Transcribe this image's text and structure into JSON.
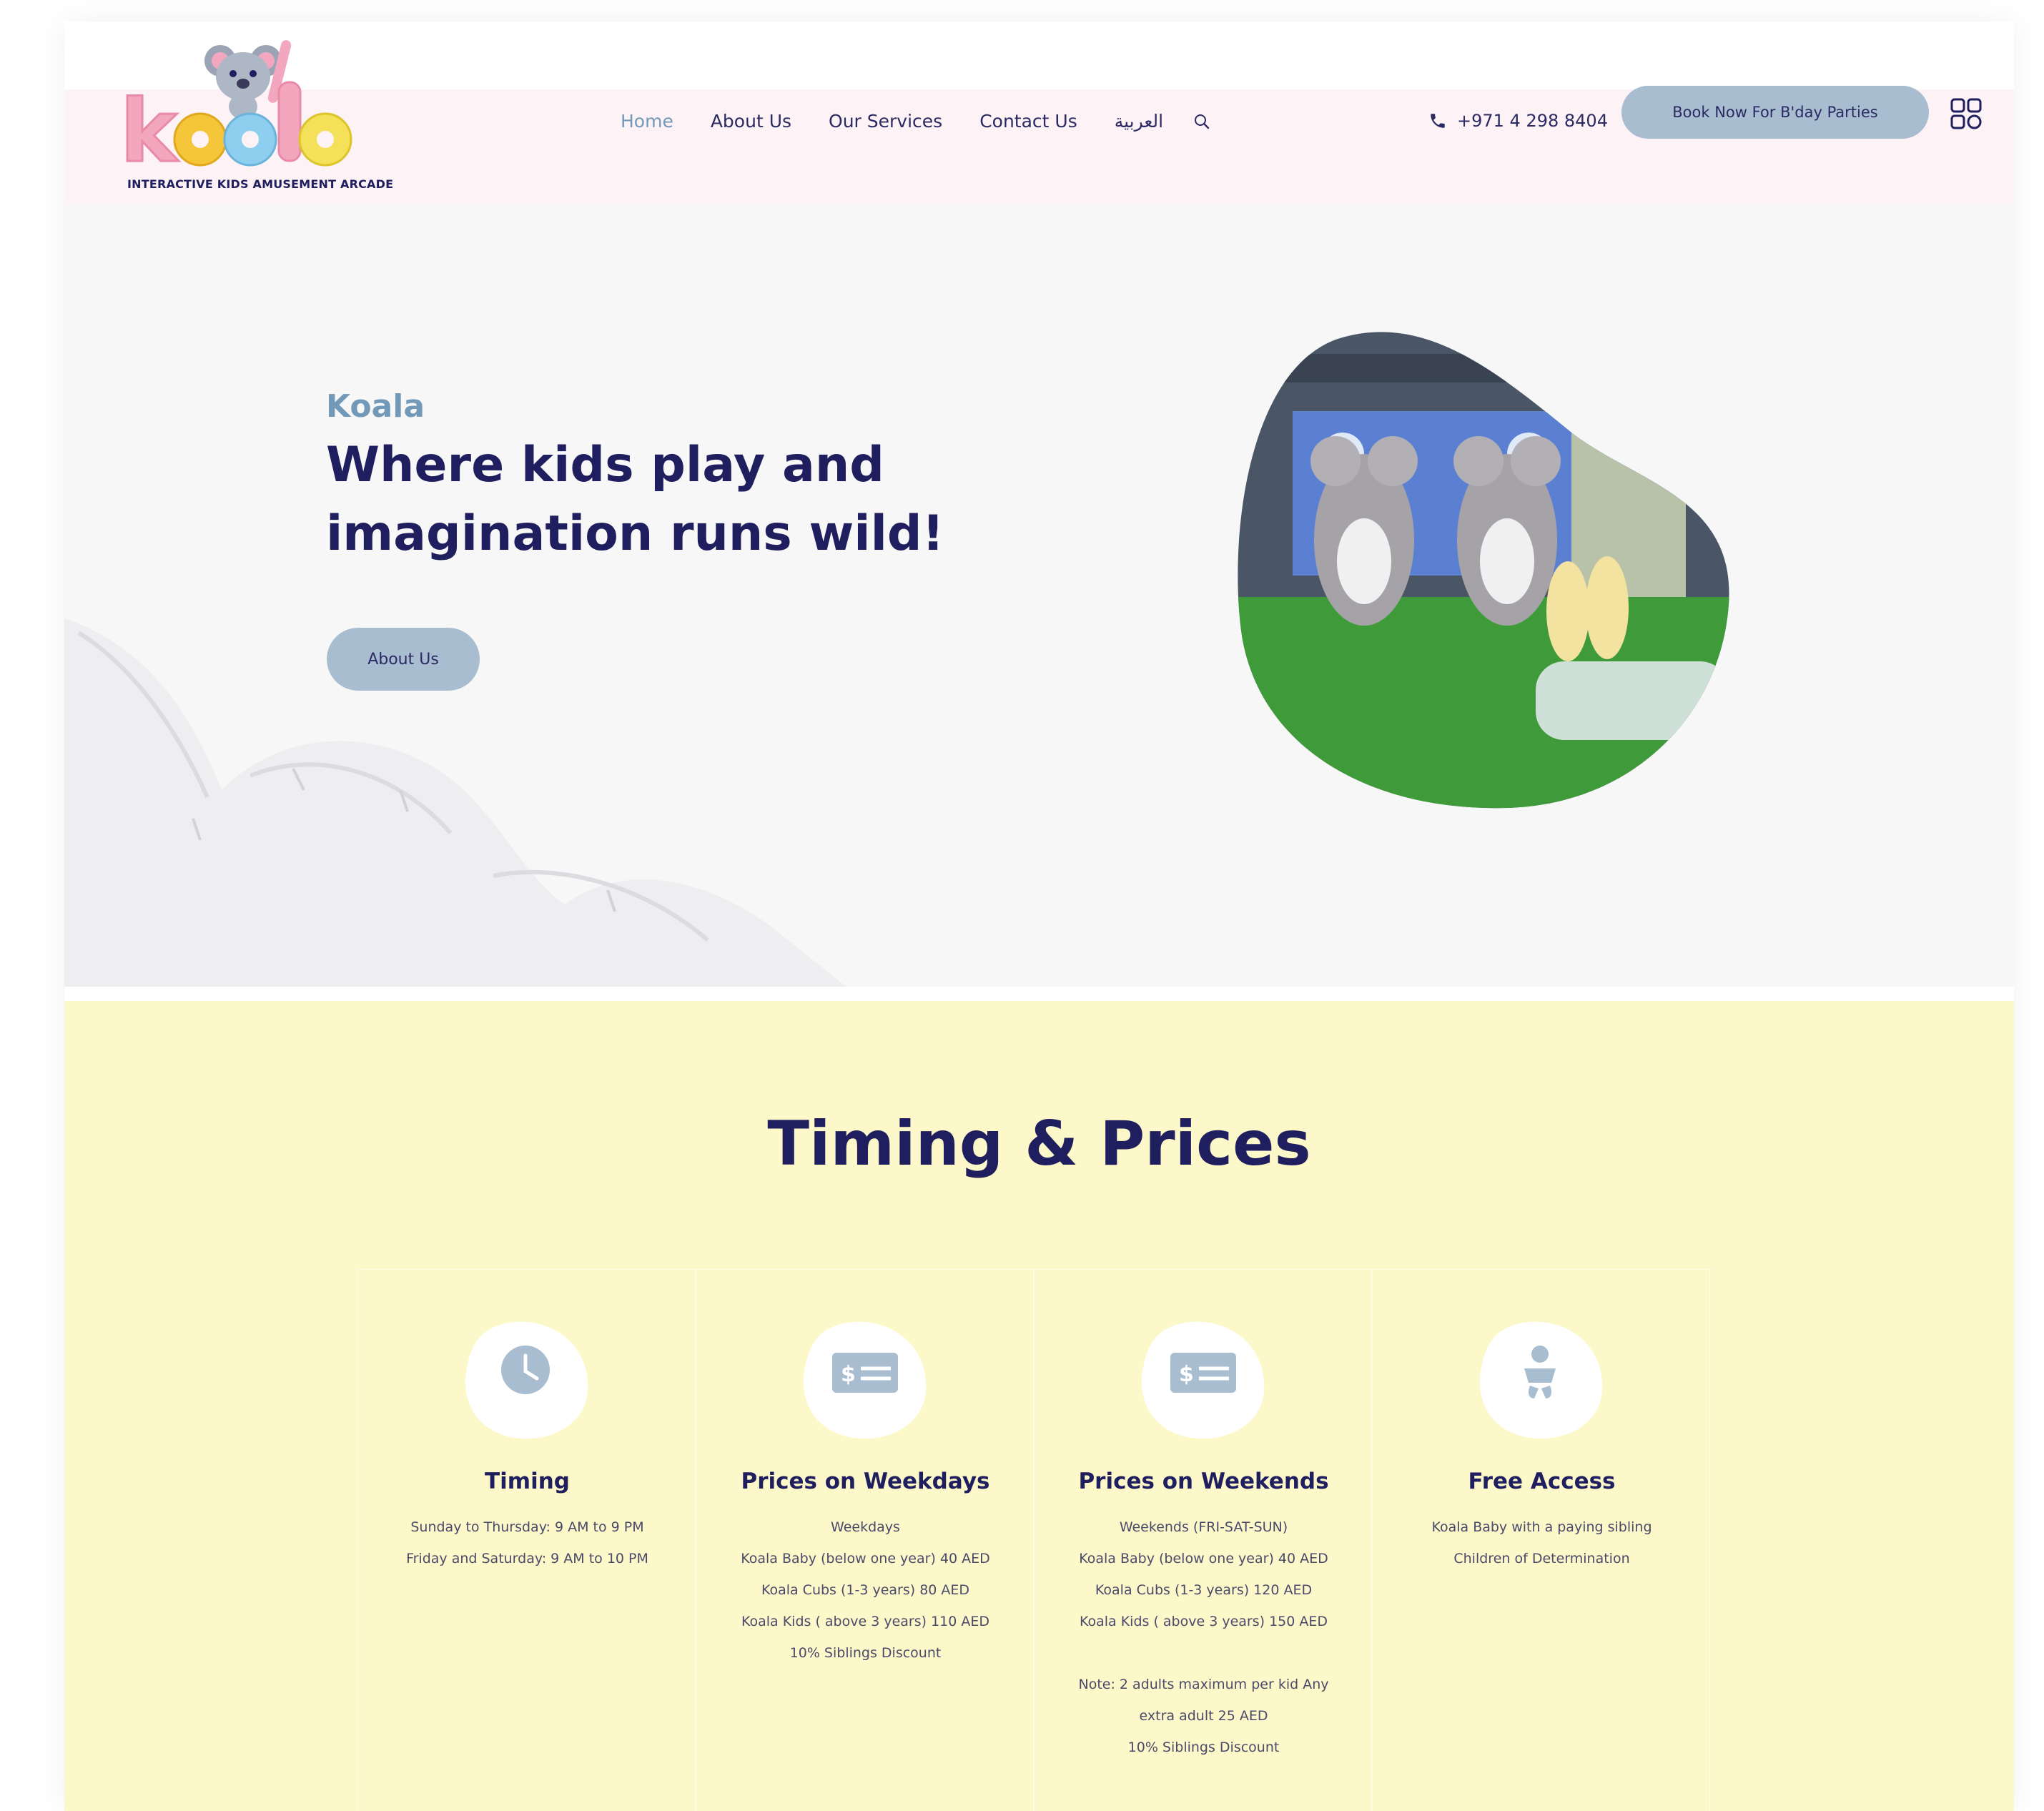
{
  "header": {
    "logo": {
      "text": "koala",
      "tagline": "INTERACTIVE KIDS AMUSEMENT ARCADE"
    },
    "nav": [
      {
        "label": "Home",
        "active": true
      },
      {
        "label": "About Us",
        "active": false
      },
      {
        "label": "Our Services",
        "active": false
      },
      {
        "label": "Contact Us",
        "active": false
      },
      {
        "label": "العربية",
        "active": false
      }
    ],
    "phone": "+971 4 298 8404",
    "book_button": "Book Now For B'day Parties",
    "icons": {
      "search": "search-icon",
      "phone": "phone-icon",
      "menu": "grid-menu-icon"
    }
  },
  "hero": {
    "eyebrow": "Koala",
    "title": "Where kids play and imagination runs wild!",
    "button": "About Us"
  },
  "prices": {
    "title": "Timing & Prices",
    "cards": [
      {
        "icon": "clock-icon",
        "title": "Timing",
        "lines": [
          "Sunday to Thursday: 9 AM to 9 PM",
          "Friday and Saturday: 9 AM to 10 PM"
        ]
      },
      {
        "icon": "money-icon",
        "title": "Prices on Weekdays",
        "lines": [
          "Weekdays",
          "Koala Baby (below one year) 40 AED",
          "Koala Cubs (1-3 years) 80 AED",
          "Koala Kids ( above 3 years) 110 AED",
          "10% Siblings Discount"
        ]
      },
      {
        "icon": "money-icon",
        "title": "Prices on Weekends",
        "lines": [
          "Weekends (FRI-SAT-SUN)",
          "Koala Baby (below one year) 40 AED",
          "Koala Cubs (1-3 years) 120 AED",
          "Koala Kids ( above 3 years) 150 AED",
          "",
          "Note: 2 adults maximum per kid Any",
          "extra adult 25 AED",
          "10% Siblings Discount"
        ]
      },
      {
        "icon": "baby-icon",
        "title": "Free Access",
        "lines": [
          "Koala Baby with a paying sibling",
          "Children of Determination"
        ]
      }
    ]
  },
  "colors": {
    "navy": "#1f1e5e",
    "accent_blue": "#7399b8",
    "button_blue": "#a9bdd0",
    "header_pink": "#fdf2f5",
    "prices_yellow": "#fdf8c9"
  }
}
